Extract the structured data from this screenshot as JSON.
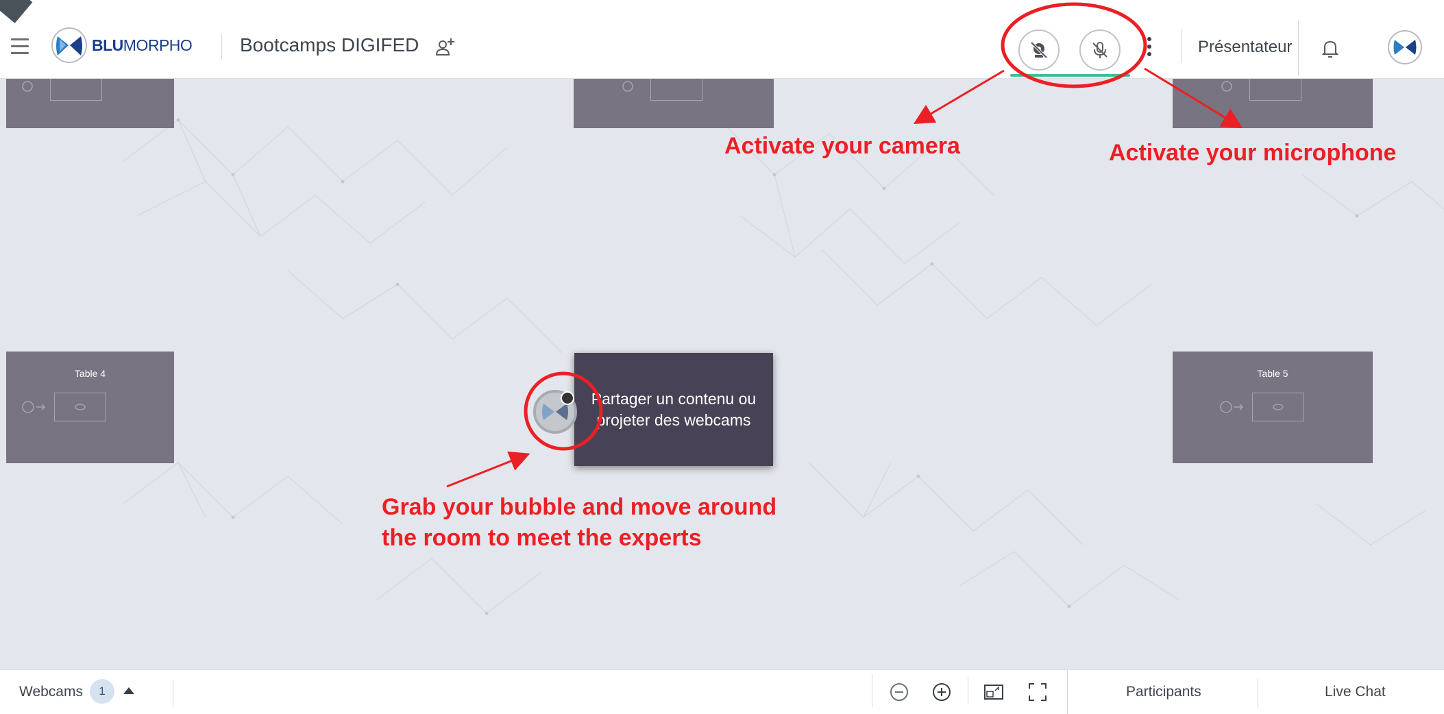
{
  "header": {
    "logo_text_bold": "BLU",
    "logo_text_rest": "MORPHO",
    "event_title": "Bootcamps DIGIFED",
    "role_label": "Présentateur"
  },
  "room": {
    "tables": [
      {
        "label": ""
      },
      {
        "label": ""
      },
      {
        "label": ""
      },
      {
        "label": "Table 4"
      },
      {
        "label": "Table 5"
      }
    ],
    "share_popover": "Partager un contenu ou projeter des webcams"
  },
  "annotations": {
    "camera": "Activate your camera",
    "microphone": "Activate your microphone",
    "bubble_line1": "Grab your bubble and move around",
    "bubble_line2": "the room to meet the experts",
    "color": "#ec1f24"
  },
  "footer": {
    "webcams_label": "Webcams",
    "webcams_count": "1",
    "participants_tab": "Participants",
    "live_chat_tab": "Live Chat"
  },
  "colors": {
    "accent_green": "#3fbf98",
    "table_card": "#787482",
    "popover_bg": "#474255",
    "canvas_bg": "#e3e6ec",
    "brand_blue": "#1d3e8a"
  },
  "icons": {
    "menu": "hamburger-icon",
    "add_user": "add-user-icon",
    "camera_off": "camera-off-icon",
    "mic_off": "mic-off-icon",
    "more": "kebab-menu-icon",
    "notifications": "bell-icon",
    "zoom_out": "zoom-out-icon",
    "zoom_in": "zoom-in-icon",
    "fit": "fit-screen-icon",
    "fullscreen": "fullscreen-icon"
  }
}
